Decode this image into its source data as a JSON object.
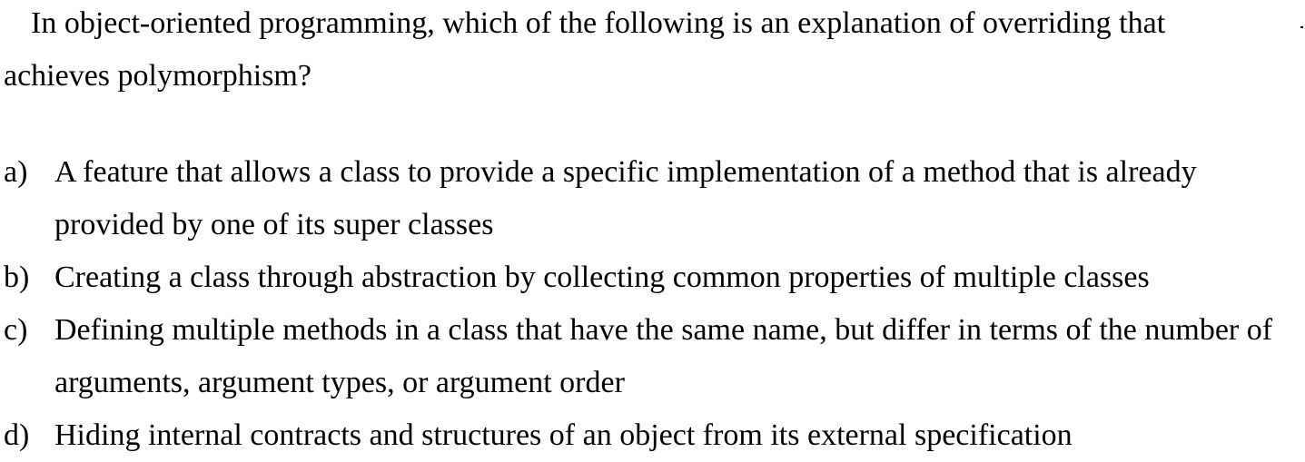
{
  "question": {
    "text": "In object-oriented programming, which of the following is an explanation of overriding that achieves polymorphism?"
  },
  "options": [
    {
      "letter": "a)",
      "text": "A feature that allows a class to provide a specific implementation of a method that is already provided by one of its super classes"
    },
    {
      "letter": "b)",
      "text": "Creating a class through abstraction by collecting common properties of multiple classes"
    },
    {
      "letter": "c)",
      "text": "Defining multiple methods in a class that have the same name, but differ in terms of the number of arguments, argument types, or argument order"
    },
    {
      "letter": "d)",
      "text": "Hiding internal contracts and structures of an object from its external specification"
    }
  ]
}
